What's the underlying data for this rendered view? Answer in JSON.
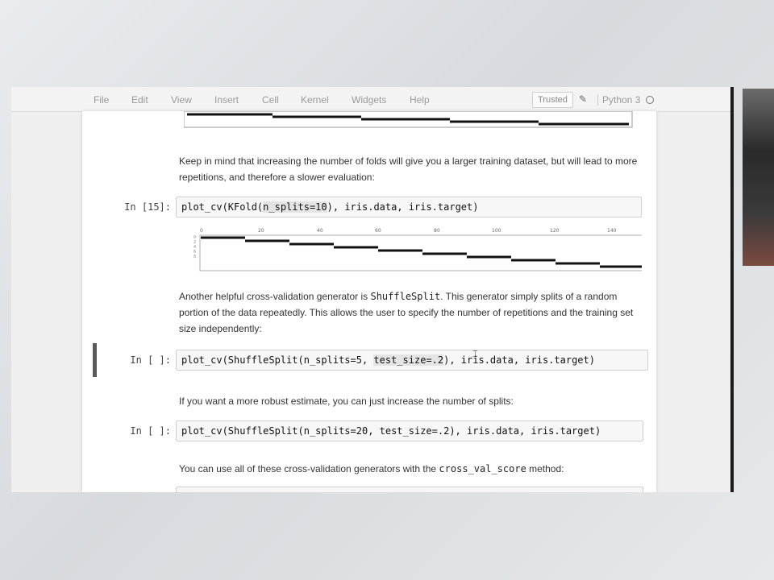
{
  "menu": [
    "File",
    "Edit",
    "View",
    "Insert",
    "Cell",
    "Kernel",
    "Widgets",
    "Help"
  ],
  "toolbar": {
    "trusted": "Trusted",
    "kernel": "Python 3"
  },
  "icons": {
    "pencil": "pencil-icon",
    "kernel_status": "circle-icon"
  },
  "cells": {
    "md1": "Keep in mind that increasing the number of folds will give you a larger training dataset, but will lead to more repetitions, and therefore a slower evaluation:",
    "c1_prompt": "In [15]:",
    "c1_pre": "plot_cv(KFold(",
    "c1_hl": "n_splits=10",
    "c1_post": "), iris.data, iris.target)",
    "plot_ticks": [
      "0",
      "20",
      "40",
      "60",
      "80",
      "100",
      "120",
      "140"
    ],
    "md2_a": "Another helpful cross-validation generator is ",
    "md2_code": "ShuffleSplit",
    "md2_b": ". This generator simply splits of a random portion of the data repeatedly. This allows the user to specify the number of repetitions and the training set size independently:",
    "c2_prompt": "In [ ]:",
    "c2_pre": "plot_cv(ShuffleSplit(n_splits=5, ",
    "c2_hl": "test_size=.2",
    "c2_post": "), iris.data, iris.target)",
    "md3": "If you want a more robust estimate, you can just increase the number of splits:",
    "c3_prompt": "In [ ]:",
    "c3_code": "plot_cv(ShuffleSplit(n_splits=20, test_size=.2), iris.data, iris.target)",
    "md4_a": "You can use all of these cross-validation generators with the ",
    "md4_code": "cross_val_score",
    "md4_b": " method:"
  }
}
